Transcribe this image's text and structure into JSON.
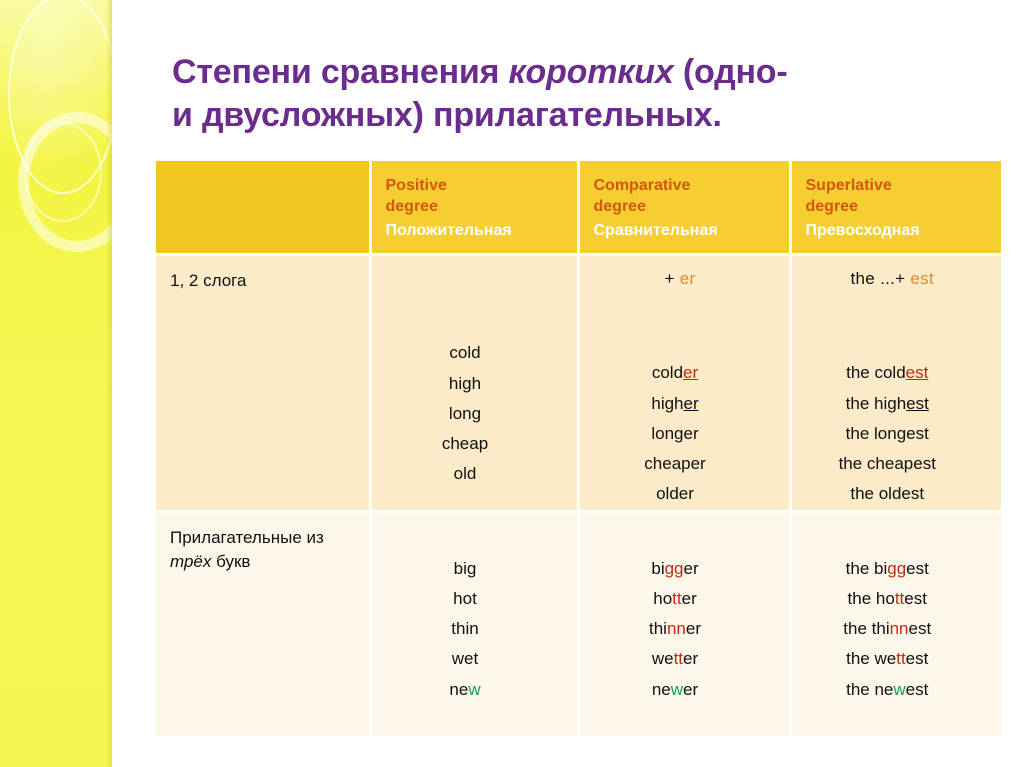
{
  "title": {
    "line1_a": "Степени сравнения ",
    "line1_italic": "коротких",
    "line1_b": " (одно-",
    "line2": "и двусложных) прилагательных."
  },
  "table": {
    "headers": [
      {
        "english_line1": "",
        "english_line2": "",
        "russian": ""
      },
      {
        "english_line1": "Positive",
        "english_line2": "degree",
        "russian": "Положительная"
      },
      {
        "english_line1": "Comparative",
        "english_line2": "degree",
        "russian": "Сравнительная"
      },
      {
        "english_line1": "Superlative",
        "english_line2": "degree",
        "russian": "Превосходная"
      }
    ],
    "rows": [
      {
        "label_plain": "1, 2 слога",
        "label_italic": "",
        "label_tail": "",
        "rule_positive": "",
        "rule_comparative_plus": "+ ",
        "rule_comparative_suffix": "er",
        "rule_superlative_prefix": "the ...+ ",
        "rule_superlative_suffix": "est",
        "positive": [
          "cold",
          "high",
          "long",
          "cheap",
          "old"
        ],
        "comparative": [
          {
            "stem": "cold",
            "mark": "er",
            "mark_style": "u-red",
            "tail": ""
          },
          {
            "stem": "high",
            "mark": "er",
            "mark_style": "u-blk",
            "tail": ""
          },
          {
            "stem": "longer",
            "mark": "",
            "mark_style": "",
            "tail": ""
          },
          {
            "stem": "cheaper",
            "mark": "",
            "mark_style": "",
            "tail": ""
          },
          {
            "stem": "older",
            "mark": "",
            "mark_style": "",
            "tail": ""
          }
        ],
        "superlative": [
          {
            "stem": "the cold",
            "mark": "est",
            "mark_style": "u-red",
            "tail": ""
          },
          {
            "stem": "the high",
            "mark": "est",
            "mark_style": "u-blk",
            "tail": ""
          },
          {
            "stem": "the longest",
            "mark": "",
            "mark_style": "",
            "tail": ""
          },
          {
            "stem": "the cheapest",
            "mark": "",
            "mark_style": "",
            "tail": ""
          },
          {
            "stem": "the oldest",
            "mark": "",
            "mark_style": "",
            "tail": ""
          }
        ]
      },
      {
        "label_plain": "Прилагательные из ",
        "label_italic": "трёх",
        "label_tail": " букв",
        "rule_positive": "",
        "rule_comparative_plus": "",
        "rule_comparative_suffix": "",
        "rule_superlative_prefix": "",
        "rule_superlative_suffix": "",
        "positive": [
          "big",
          "hot",
          "thin",
          "wet",
          "new"
        ],
        "positive_marked": [
          {
            "stem": "big",
            "mark": "",
            "mark_style": "",
            "tail": ""
          },
          {
            "stem": "hot",
            "mark": "",
            "mark_style": "",
            "tail": ""
          },
          {
            "stem": "thin",
            "mark": "",
            "mark_style": "",
            "tail": ""
          },
          {
            "stem": "wet",
            "mark": "",
            "mark_style": "",
            "tail": ""
          },
          {
            "stem": "ne",
            "mark": "w",
            "mark_style": "green",
            "tail": ""
          }
        ],
        "comparative": [
          {
            "stem": "bi",
            "mark": "gg",
            "mark_style": "red",
            "tail": "er"
          },
          {
            "stem": "ho",
            "mark": "tt",
            "mark_style": "red",
            "tail": "er"
          },
          {
            "stem": "thi",
            "mark": "nn",
            "mark_style": "red",
            "tail": "er"
          },
          {
            "stem": "we",
            "mark": "tt",
            "mark_style": "red",
            "tail": "er"
          },
          {
            "stem": "ne",
            "mark": "w",
            "mark_style": "green",
            "tail": "er"
          }
        ],
        "superlative": [
          {
            "stem": "the bi",
            "mark": "gg",
            "mark_style": "red",
            "tail": "est"
          },
          {
            "stem": "the ho",
            "mark": "tt",
            "mark_style": "red",
            "tail": "est"
          },
          {
            "stem": "the thi",
            "mark": "nn",
            "mark_style": "red",
            "tail": "est"
          },
          {
            "stem": "the we",
            "mark": "tt",
            "mark_style": "red",
            "tail": "est"
          },
          {
            "stem": "the ne",
            "mark": "w",
            "mark_style": "green",
            "tail": "est"
          }
        ]
      }
    ]
  },
  "colors": {
    "title_purple": "#6A2D8E",
    "header_gold": "#F5CE32",
    "header_gold_blank": "#F2C620",
    "header_english_orange": "#D4570C",
    "header_russian_white": "#FFFFFF",
    "row1_cream": "#FBEBC8",
    "row2_cream_light": "#FDF7EA",
    "suffix_orange": "#E08B28",
    "mark_red": "#C22A14",
    "mark_green": "#16A05A",
    "sidebar_yellow": "#F4F54C",
    "text_black": "#111111"
  }
}
